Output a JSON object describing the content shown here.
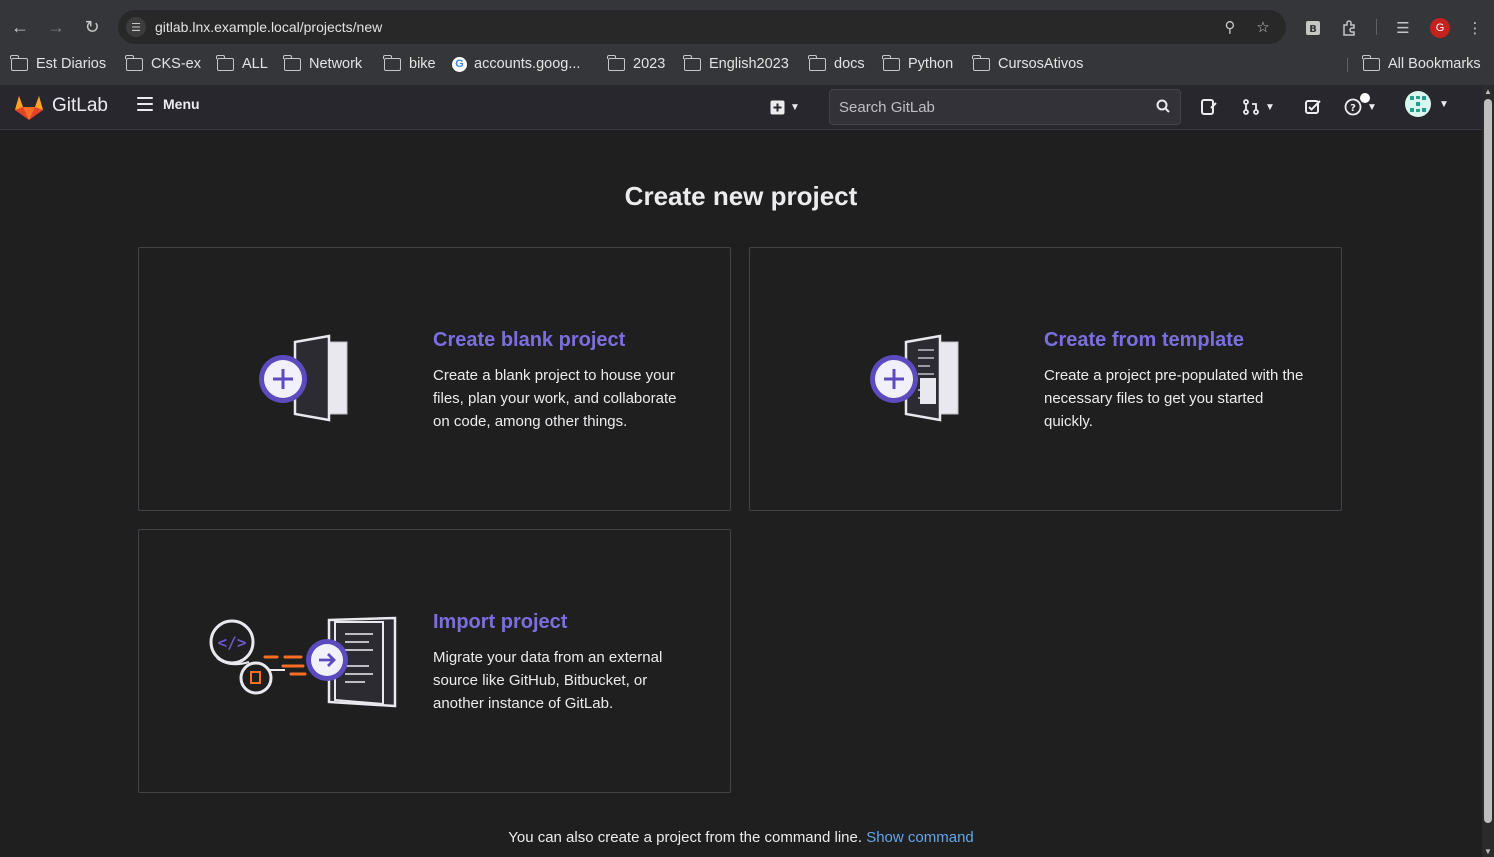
{
  "browser": {
    "url": "gitlab.lnx.example.local/projects/new",
    "bookmarks": [
      {
        "label": "Est Diarios",
        "icon": "folder-icon"
      },
      {
        "label": "CKS-ex",
        "icon": "folder-icon"
      },
      {
        "label": "ALL",
        "icon": "folder-icon"
      },
      {
        "label": "Network",
        "icon": "folder-icon"
      },
      {
        "label": "bike",
        "icon": "folder-icon"
      },
      {
        "label": "accounts.goog...",
        "icon": "google-icon"
      },
      {
        "label": "2023",
        "icon": "folder-icon"
      },
      {
        "label": "English2023",
        "icon": "folder-icon"
      },
      {
        "label": "docs",
        "icon": "folder-icon"
      },
      {
        "label": "Python",
        "icon": "folder-icon"
      },
      {
        "label": "CursosAtivos",
        "icon": "folder-icon"
      }
    ],
    "all_bookmarks": "All Bookmarks",
    "profile_initial": "G"
  },
  "header": {
    "brand": "GitLab",
    "menu_label": "Menu",
    "search_placeholder": "Search GitLab"
  },
  "main": {
    "title": "Create new project",
    "cards": [
      {
        "title": "Create blank project",
        "description": "Create a blank project to house your files, plan your work, and collaborate on code, among other things."
      },
      {
        "title": "Create from template",
        "description": "Create a project pre-populated with the necessary files to get you started quickly."
      },
      {
        "title": "Import project",
        "description": "Migrate your data from an external source like GitHub, Bitbucket, or another instance of GitLab."
      }
    ],
    "footer_text": "You can also create a project from the command line.",
    "footer_link": "Show command"
  },
  "colors": {
    "accent": "#7b6fe0",
    "link": "#63a6e9",
    "background": "#1f1f1f"
  }
}
